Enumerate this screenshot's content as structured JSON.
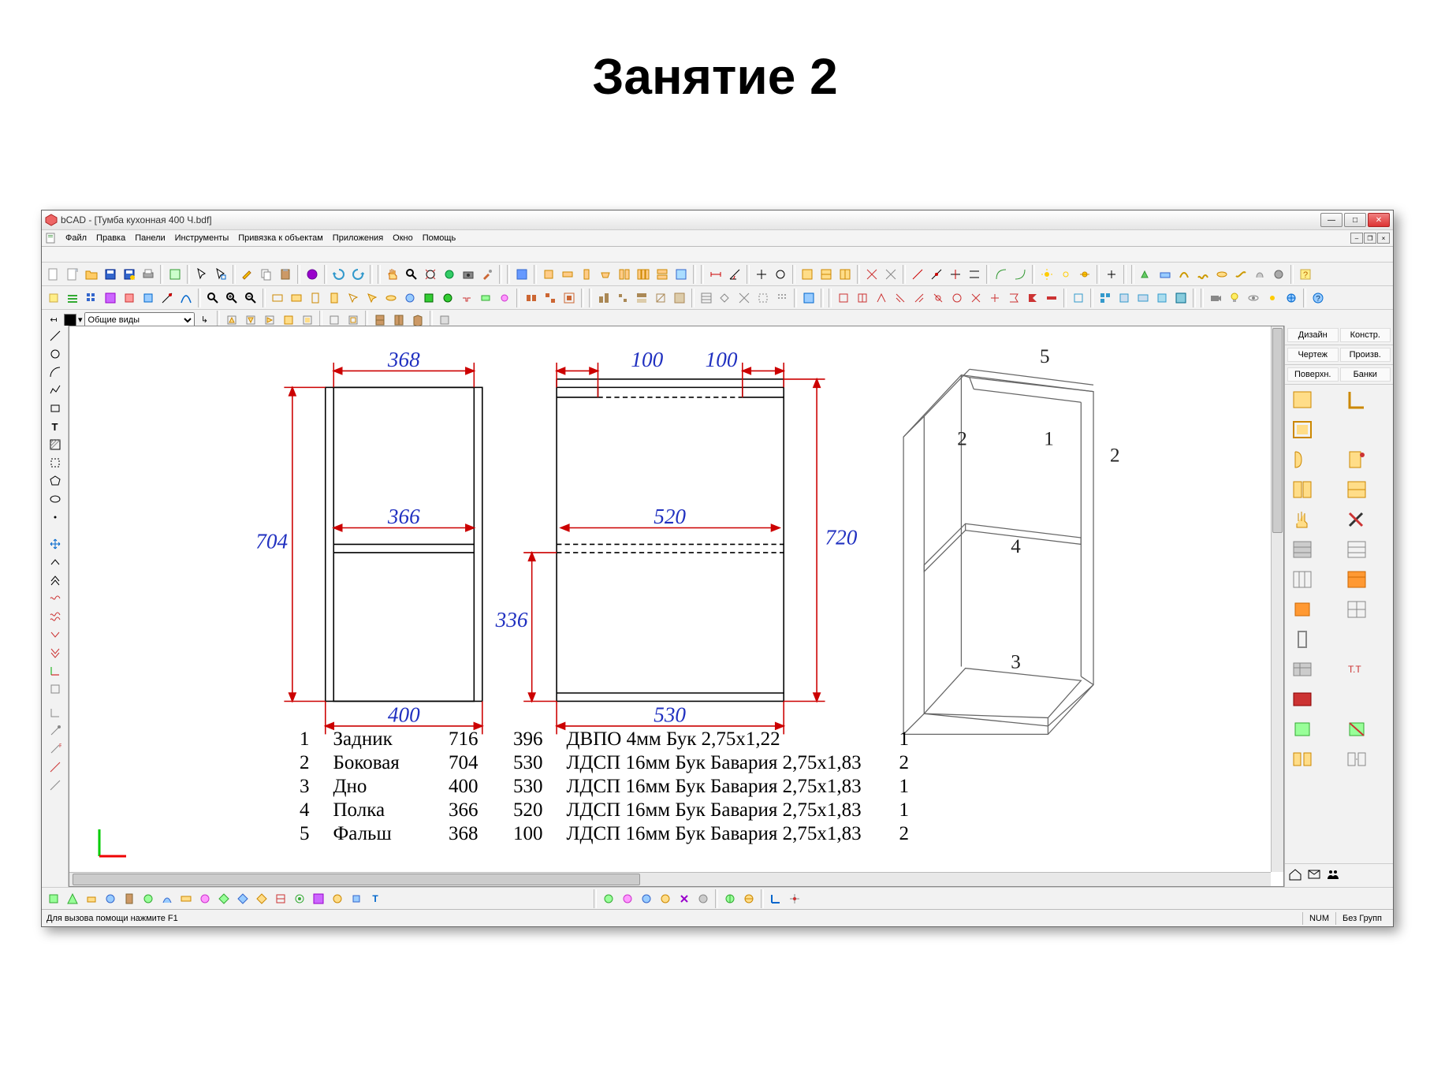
{
  "slide_title": "Занятие 2",
  "window": {
    "title": "bCAD - [Тумба кухонная 400 Ч.bdf]"
  },
  "menu": [
    "Файл",
    "Правка",
    "Панели",
    "Инструменты",
    "Привязка к объектам",
    "Приложения",
    "Окно",
    "Помощь"
  ],
  "view_selector": "Общие виды",
  "dimensions": {
    "d_368": "368",
    "d_704": "704",
    "d_366": "366",
    "d_400": "400",
    "d_100a": "100",
    "d_100b": "100",
    "d_720": "720",
    "d_520": "520",
    "d_336": "336",
    "d_530": "530"
  },
  "iso_labels": {
    "p1": "1",
    "p2": "2",
    "p2b": "2",
    "p3": "3",
    "p4": "4",
    "p5": "5"
  },
  "spec": [
    {
      "n": "1",
      "name": "Задник",
      "a": "716",
      "b": "396",
      "mat": "ДВПО 4мм Бук 2,75х1,22",
      "q": "1"
    },
    {
      "n": "2",
      "name": "Боковая",
      "a": "704",
      "b": "530",
      "mat": "ЛДСП 16мм Бук Бавария 2,75х1,83",
      "q": "2"
    },
    {
      "n": "3",
      "name": "Дно",
      "a": "400",
      "b": "530",
      "mat": "ЛДСП 16мм Бук Бавария 2,75х1,83",
      "q": "1"
    },
    {
      "n": "4",
      "name": "Полка",
      "a": "366",
      "b": "520",
      "mat": "ЛДСП 16мм Бук Бавария 2,75х1,83",
      "q": "1"
    },
    {
      "n": "5",
      "name": "Фальш",
      "a": "368",
      "b": "100",
      "mat": "ЛДСП 16мм Бук Бавария 2,75х1,83",
      "q": "2"
    }
  ],
  "right_panel": {
    "tabs1": [
      "Дизайн",
      "Констр."
    ],
    "tabs2": [
      "Чертеж",
      "Произв."
    ],
    "tabs3": [
      "Поверхн.",
      "Банки"
    ]
  },
  "status": {
    "hint": "Для вызова помощи нажмите F1",
    "num": "NUM",
    "grp": "Без Групп"
  }
}
